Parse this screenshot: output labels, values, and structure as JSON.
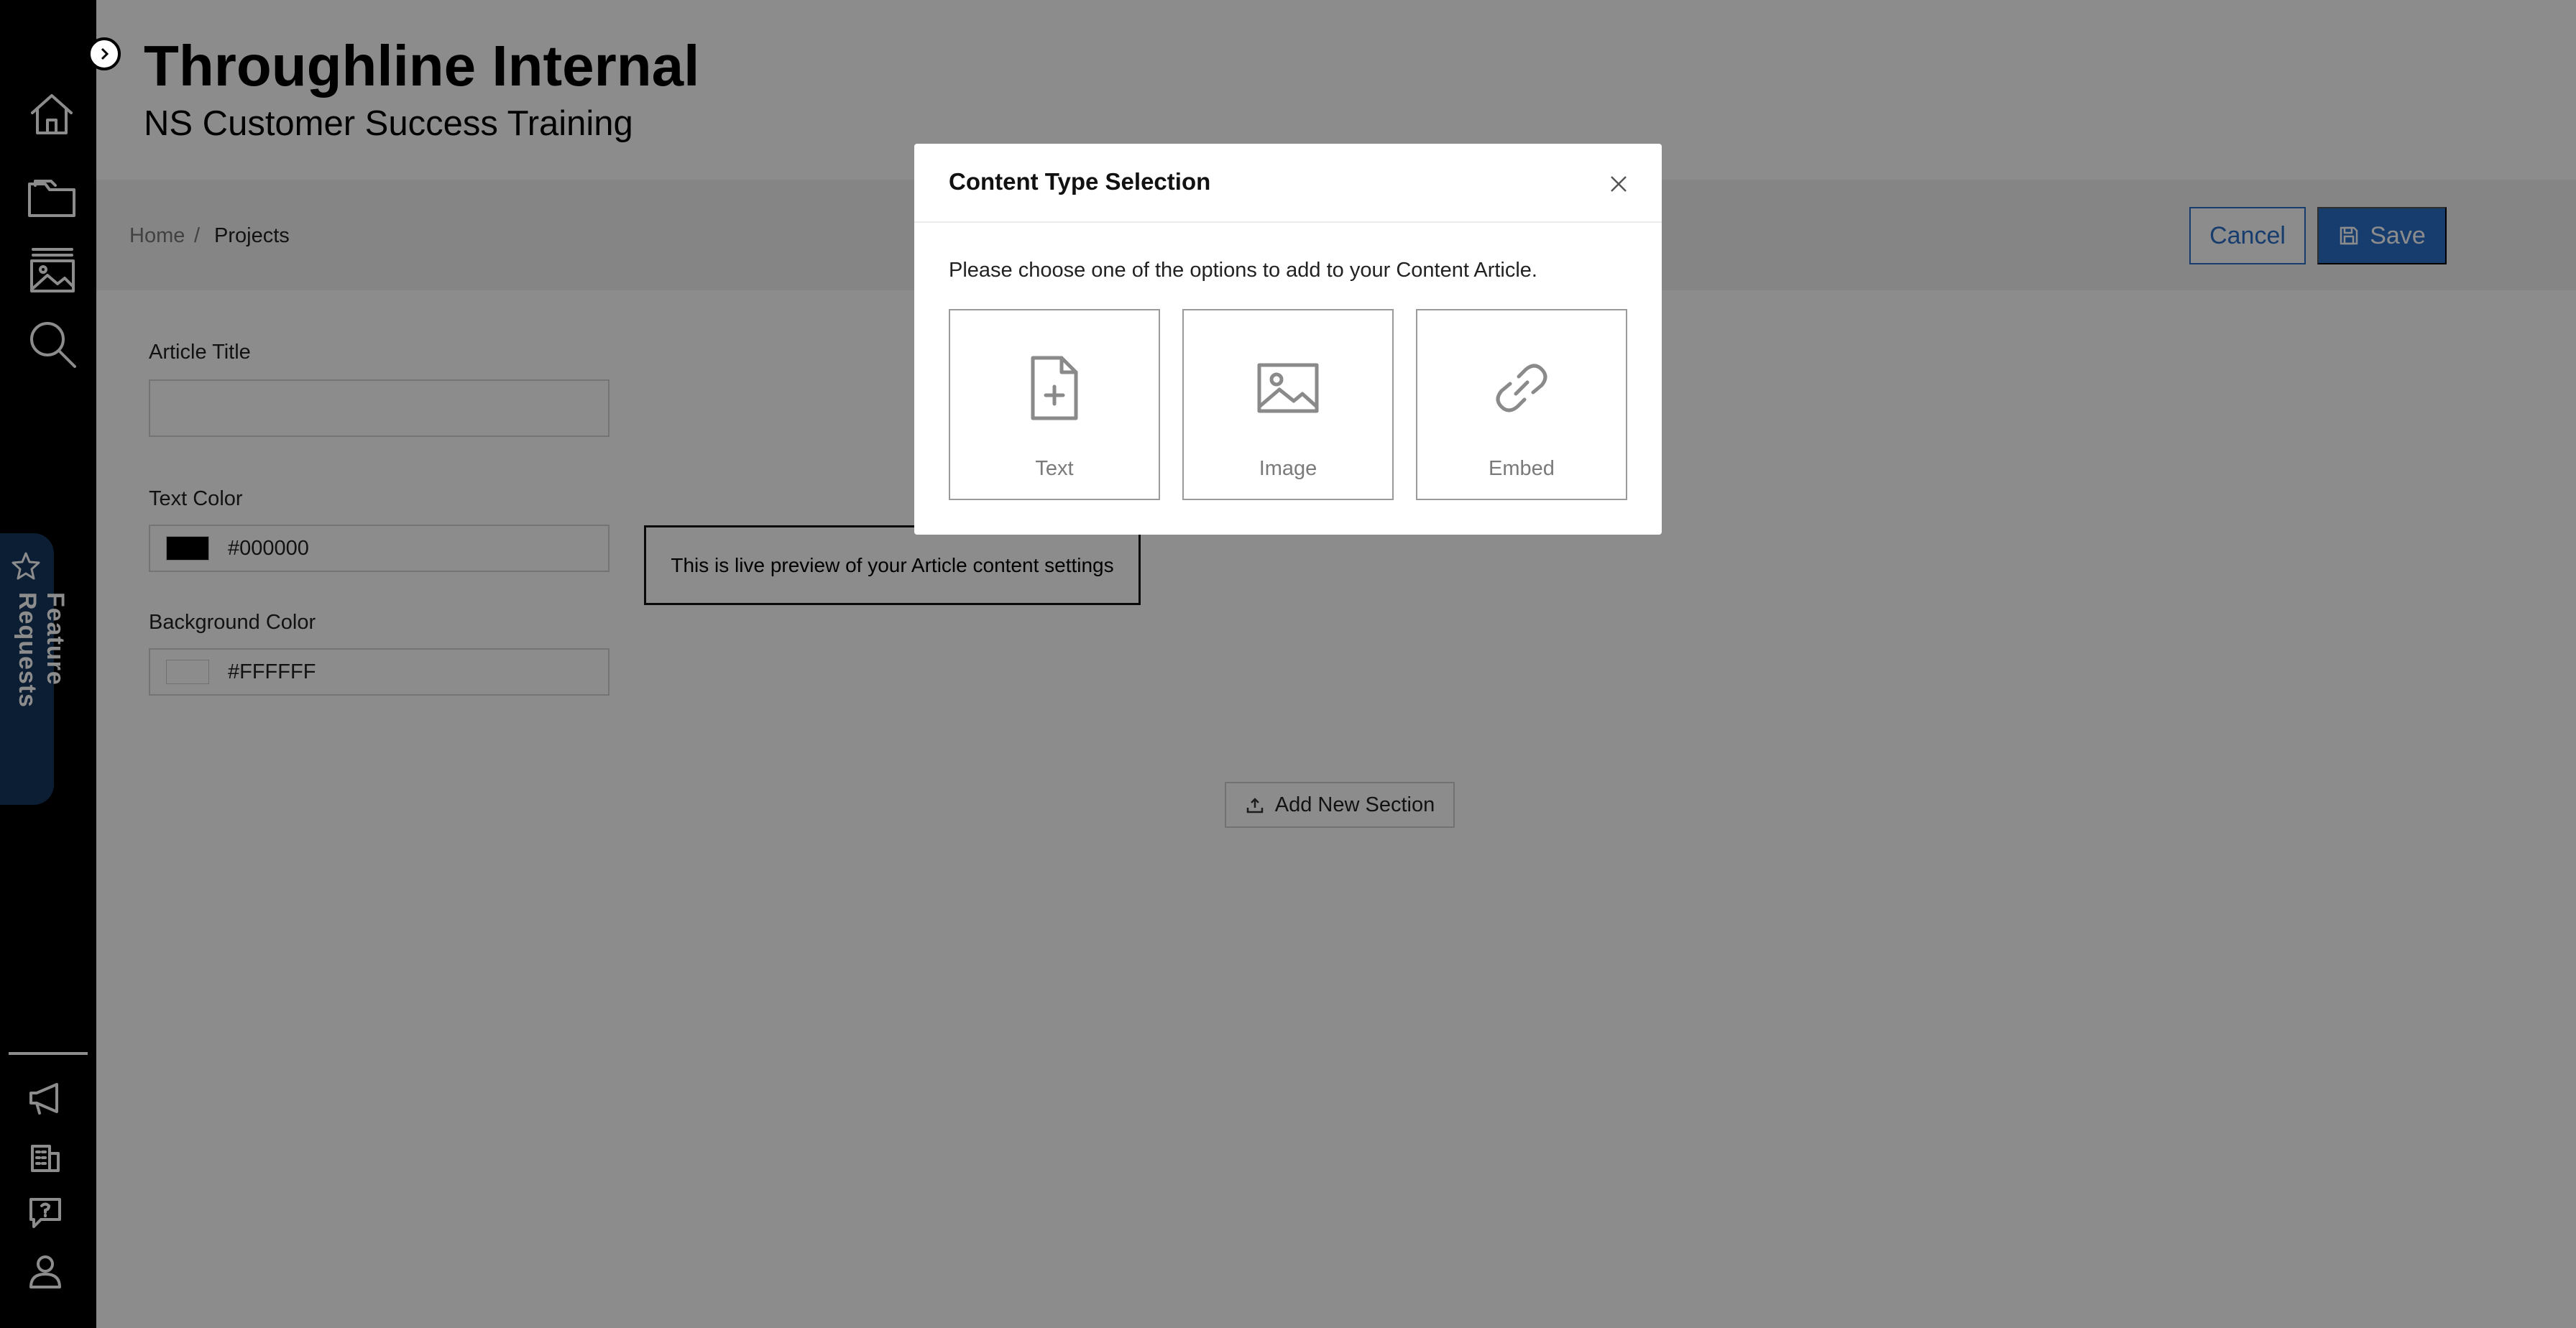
{
  "header": {
    "title": "Throughline Internal",
    "subtitle": "NS Customer Success Training"
  },
  "breadcrumb": {
    "home": "Home",
    "separator": "/",
    "current": "Projects"
  },
  "actions": {
    "cancel_label": "Cancel",
    "save_label": "Save"
  },
  "sidebar": {
    "top_items": [
      "home-icon",
      "folder-icon",
      "gallery-icon",
      "search-icon"
    ],
    "bottom_items": [
      "megaphone-icon",
      "building-icon",
      "help-chat-icon",
      "user-icon"
    ],
    "feature_tab_label": "Feature Requests"
  },
  "form": {
    "article_title_label": "Article Title",
    "article_title_value": "",
    "text_color_label": "Text Color",
    "text_color_value": "#000000",
    "background_color_label": "Background Color",
    "background_color_value": "#FFFFFF",
    "preview_text": "This is live preview of your Article content settings",
    "add_section_label": "Add New Section"
  },
  "modal": {
    "title": "Content Type Selection",
    "instruction": "Please choose one of the options to add to your Content Article.",
    "options": [
      {
        "label": "Text",
        "icon": "file-plus-icon"
      },
      {
        "label": "Image",
        "icon": "image-icon"
      },
      {
        "label": "Embed",
        "icon": "link-icon"
      }
    ]
  },
  "colors": {
    "accent": "#2a6ec8",
    "sidebar": "#000000",
    "feature_tab": "#16375d"
  }
}
